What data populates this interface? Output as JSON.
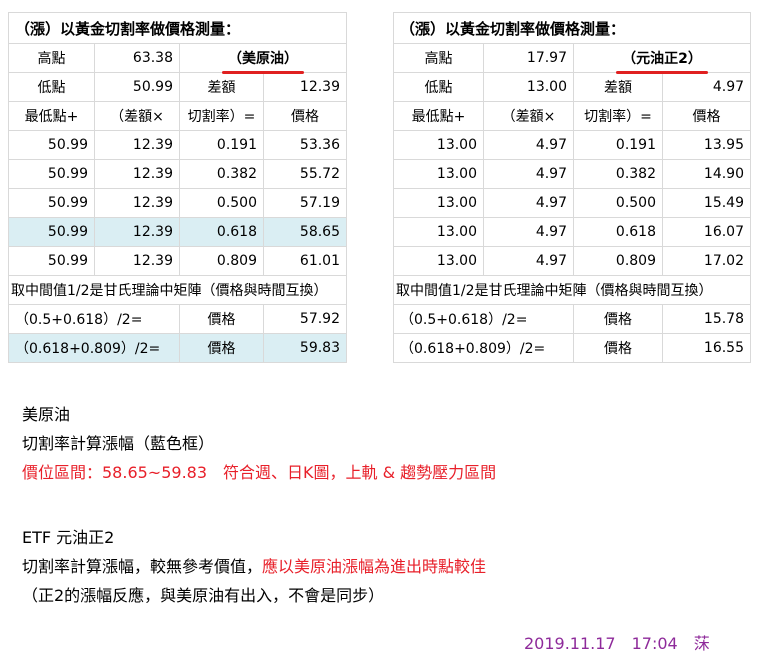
{
  "left_table": {
    "title": "（漲）以黃金切割率做價格測量：",
    "high_label": "高點",
    "high_value": "63.38",
    "product_name": "（美原油）",
    "low_label": "低點",
    "low_value": "50.99",
    "diff_label": "差額",
    "diff_value": "12.39",
    "formula_headers": [
      "最低點+",
      "（差額×",
      "切割率）=",
      "價格"
    ],
    "rows": [
      [
        "50.99",
        "12.39",
        "0.191",
        "53.36"
      ],
      [
        "50.99",
        "12.39",
        "0.382",
        "55.72"
      ],
      [
        "50.99",
        "12.39",
        "0.500",
        "57.19"
      ],
      [
        "50.99",
        "12.39",
        "0.618",
        "58.65"
      ],
      [
        "50.99",
        "12.39",
        "0.809",
        "61.01"
      ]
    ],
    "note": "取中間值1/2是甘氏理論中矩陣（價格與時間互換）",
    "mid_rows": [
      {
        "formula": "（0.5+0.618）/2=",
        "label": "價格",
        "value": "57.92"
      },
      {
        "formula": "（0.618+0.809）/2=",
        "label": "價格",
        "value": "59.83"
      }
    ]
  },
  "right_table": {
    "title": "（漲）以黃金切割率做價格測量：",
    "high_label": "高點",
    "high_value": "17.97",
    "product_name": "（元油正2）",
    "low_label": "低點",
    "low_value": "13.00",
    "diff_label": "差額",
    "diff_value": "4.97",
    "formula_headers": [
      "最低點+",
      "（差額×",
      "切割率）=",
      "價格"
    ],
    "rows": [
      [
        "13.00",
        "4.97",
        "0.191",
        "13.95"
      ],
      [
        "13.00",
        "4.97",
        "0.382",
        "14.90"
      ],
      [
        "13.00",
        "4.97",
        "0.500",
        "15.49"
      ],
      [
        "13.00",
        "4.97",
        "0.618",
        "16.07"
      ],
      [
        "13.00",
        "4.97",
        "0.809",
        "17.02"
      ]
    ],
    "note": "取中間值1/2是甘氏理論中矩陣（價格與時間互換）",
    "mid_rows": [
      {
        "formula": "（0.5+0.618）/2=",
        "label": "價格",
        "value": "15.78"
      },
      {
        "formula": "（0.618+0.809）/2=",
        "label": "價格",
        "value": "16.55"
      }
    ]
  },
  "notes": {
    "oil_heading": "美原油",
    "oil_line1": "切割率計算漲幅（藍色框）",
    "oil_line2": "價位區間：58.65~59.83　符合週、日K圖，上軌 & 趨勢壓力區間",
    "etf_heading": "ETF 元油正2",
    "etf_line1_black": "切割率計算漲幅，較無參考價值，",
    "etf_line1_red": "應以美原油漲幅為進出時點較佳",
    "etf_line2": "（正2的漲幅反應，與美原油有出入，不會是同步）"
  },
  "signature": "2019.11.17　17:04　莯",
  "colors": {
    "highlight": "#daeef3",
    "red_text": "#e8202a",
    "signature": "#8e2a9a",
    "underline": "#e02020"
  }
}
